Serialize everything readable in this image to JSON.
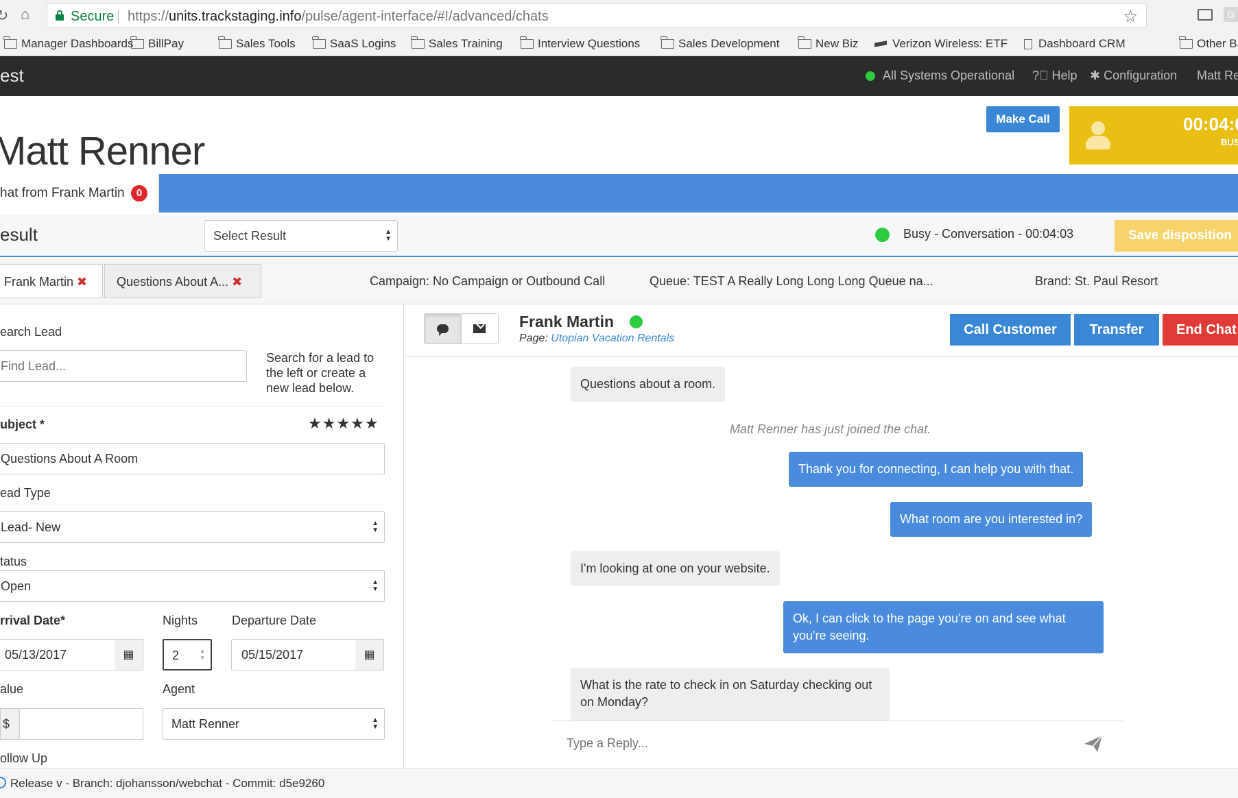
{
  "browser": {
    "secure_label": "Secure",
    "url_scheme": "https://",
    "url_host": "units.trackstaging.info",
    "url_path": "/pulse/agent-interface/#!/advanced/chats",
    "bookmarks": [
      "Manager Dashboards",
      "BillPay",
      "Sales Tools",
      "SaaS Logins",
      "Sales Training",
      "Interview Questions",
      "Sales Development",
      "New Biz",
      "Verizon Wireless: ETF",
      "Dashboard CRM"
    ],
    "other_bookmarks": "Other B",
    "extension_letter": "G"
  },
  "header": {
    "brand": "est",
    "system_status": "All Systems Operational",
    "help": "Help",
    "configuration": "Configuration",
    "user": "Matt Re",
    "status_color": "#2ecc40"
  },
  "agent": {
    "name": "Matt Renner",
    "make_call": "Make Call",
    "timer": "00:04:0",
    "state": "BUS",
    "state_color": "#eabf14"
  },
  "chat_tab": {
    "label": "hat from Frank Martin",
    "badge": "0"
  },
  "result": {
    "title": "esult",
    "select_placeholder": "Select Result",
    "status_text": "Busy - Conversation -  00:04:03",
    "save_label": "Save disposition"
  },
  "info": {
    "tabs": [
      "Frank Martin",
      "Questions About A..."
    ],
    "campaign": "Campaign: No Campaign or Outbound Call",
    "queue": "Queue: TEST A Really Long Long Long Queue na...",
    "brand": "Brand: St. Paul Resort"
  },
  "form": {
    "search_label": "earch Lead",
    "search_placeholder": "Find Lead...",
    "search_help": [
      "Search for a lead to",
      "the left or create a",
      "new lead below."
    ],
    "subject_label": "ubject *",
    "rating_stars": "★★★★★",
    "subject_value": "Questions About A Room",
    "lead_type_label": "ead Type",
    "lead_type_value": "Lead- New",
    "status_label": "tatus",
    "status_value": "Open",
    "arrival_label": "rrival Date*",
    "arrival_value": "05/13/2017",
    "nights_label": "Nights",
    "nights_value": "2",
    "departure_label": "Departure Date",
    "departure_value": "05/15/2017",
    "value_label": "alue",
    "value_prefix": "$",
    "agent_label": "Agent",
    "agent_value": "Matt Renner",
    "follow_up_label": "ollow Up"
  },
  "chat": {
    "customer_name": "Frank Martin",
    "page_label": "Page:",
    "page_link": "Utopian Vacation Rentals",
    "call_customer": "Call Customer",
    "transfer": "Transfer",
    "end_chat": "End Chat",
    "system_message": "Matt Renner has just joined the chat.",
    "messages": [
      {
        "from": "customer",
        "text": "Questions about a room."
      },
      {
        "from": "agent",
        "text": "Thank you for connecting, I can help you with that."
      },
      {
        "from": "agent",
        "text": "What room are you interested in?"
      },
      {
        "from": "customer",
        "text": "I'm looking at one on your website."
      },
      {
        "from": "agent",
        "text": "Ok, I can click to the page you're on and see what you're seeing."
      },
      {
        "from": "customer",
        "text": "What is the rate to check in on Saturday checking out on Monday?"
      }
    ],
    "reply_placeholder": "Type a Reply..."
  },
  "footer": {
    "text": "Release v - Branch: djohansson/webchat - Commit: d5e9260"
  }
}
